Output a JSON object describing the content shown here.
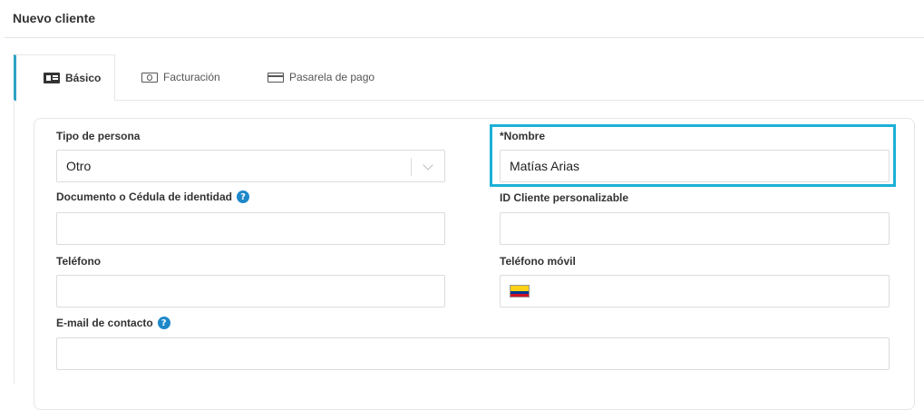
{
  "page": {
    "title": "Nuevo cliente"
  },
  "tabs": [
    {
      "label": "Básico",
      "icon": "id-card-icon",
      "active": true
    },
    {
      "label": "Facturación",
      "icon": "money-bill-icon",
      "active": false
    },
    {
      "label": "Pasarela de pago",
      "icon": "credit-card-icon",
      "active": false
    }
  ],
  "form": {
    "tipo_persona": {
      "label": "Tipo de persona",
      "value": "Otro"
    },
    "nombre": {
      "label": "*Nombre",
      "value": "Matías Arias"
    },
    "documento": {
      "label": "Documento o Cédula de identidad",
      "value": ""
    },
    "id_cliente": {
      "label": "ID Cliente personalizable",
      "value": ""
    },
    "telefono": {
      "label": "Teléfono",
      "value": ""
    },
    "telefono_movil": {
      "label": "Teléfono móvil",
      "value": "",
      "flag": "colombia-flag-icon"
    },
    "email": {
      "label": "E-mail de contacto",
      "value": ""
    },
    "help_glyph": "?"
  },
  "colors": {
    "accent": "#2fa1c4",
    "highlight": "#1cb0d6",
    "help": "#1e88c9"
  }
}
